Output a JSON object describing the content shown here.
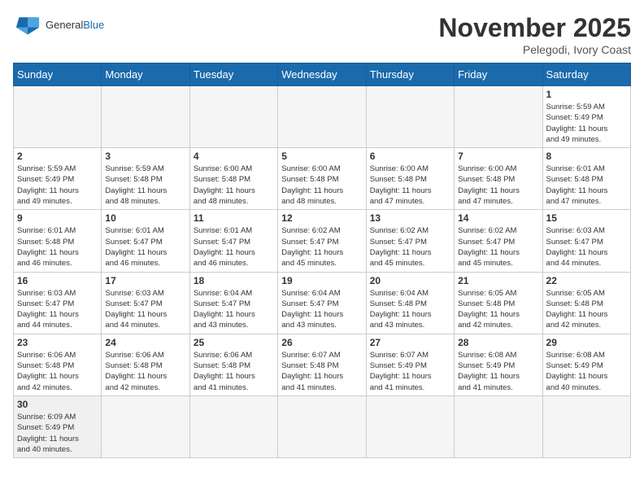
{
  "header": {
    "logo_general": "General",
    "logo_blue": "Blue",
    "month_title": "November 2025",
    "location": "Pelegodi, Ivory Coast"
  },
  "days_of_week": [
    "Sunday",
    "Monday",
    "Tuesday",
    "Wednesday",
    "Thursday",
    "Friday",
    "Saturday"
  ],
  "weeks": [
    [
      {
        "day": "",
        "info": ""
      },
      {
        "day": "",
        "info": ""
      },
      {
        "day": "",
        "info": ""
      },
      {
        "day": "",
        "info": ""
      },
      {
        "day": "",
        "info": ""
      },
      {
        "day": "",
        "info": ""
      },
      {
        "day": "1",
        "info": "Sunrise: 5:59 AM\nSunset: 5:49 PM\nDaylight: 11 hours\nand 49 minutes."
      }
    ],
    [
      {
        "day": "2",
        "info": "Sunrise: 5:59 AM\nSunset: 5:49 PM\nDaylight: 11 hours\nand 49 minutes."
      },
      {
        "day": "3",
        "info": "Sunrise: 5:59 AM\nSunset: 5:48 PM\nDaylight: 11 hours\nand 48 minutes."
      },
      {
        "day": "4",
        "info": "Sunrise: 6:00 AM\nSunset: 5:48 PM\nDaylight: 11 hours\nand 48 minutes."
      },
      {
        "day": "5",
        "info": "Sunrise: 6:00 AM\nSunset: 5:48 PM\nDaylight: 11 hours\nand 48 minutes."
      },
      {
        "day": "6",
        "info": "Sunrise: 6:00 AM\nSunset: 5:48 PM\nDaylight: 11 hours\nand 47 minutes."
      },
      {
        "day": "7",
        "info": "Sunrise: 6:00 AM\nSunset: 5:48 PM\nDaylight: 11 hours\nand 47 minutes."
      },
      {
        "day": "8",
        "info": "Sunrise: 6:01 AM\nSunset: 5:48 PM\nDaylight: 11 hours\nand 47 minutes."
      }
    ],
    [
      {
        "day": "9",
        "info": "Sunrise: 6:01 AM\nSunset: 5:48 PM\nDaylight: 11 hours\nand 46 minutes."
      },
      {
        "day": "10",
        "info": "Sunrise: 6:01 AM\nSunset: 5:47 PM\nDaylight: 11 hours\nand 46 minutes."
      },
      {
        "day": "11",
        "info": "Sunrise: 6:01 AM\nSunset: 5:47 PM\nDaylight: 11 hours\nand 46 minutes."
      },
      {
        "day": "12",
        "info": "Sunrise: 6:02 AM\nSunset: 5:47 PM\nDaylight: 11 hours\nand 45 minutes."
      },
      {
        "day": "13",
        "info": "Sunrise: 6:02 AM\nSunset: 5:47 PM\nDaylight: 11 hours\nand 45 minutes."
      },
      {
        "day": "14",
        "info": "Sunrise: 6:02 AM\nSunset: 5:47 PM\nDaylight: 11 hours\nand 45 minutes."
      },
      {
        "day": "15",
        "info": "Sunrise: 6:03 AM\nSunset: 5:47 PM\nDaylight: 11 hours\nand 44 minutes."
      }
    ],
    [
      {
        "day": "16",
        "info": "Sunrise: 6:03 AM\nSunset: 5:47 PM\nDaylight: 11 hours\nand 44 minutes."
      },
      {
        "day": "17",
        "info": "Sunrise: 6:03 AM\nSunset: 5:47 PM\nDaylight: 11 hours\nand 44 minutes."
      },
      {
        "day": "18",
        "info": "Sunrise: 6:04 AM\nSunset: 5:47 PM\nDaylight: 11 hours\nand 43 minutes."
      },
      {
        "day": "19",
        "info": "Sunrise: 6:04 AM\nSunset: 5:47 PM\nDaylight: 11 hours\nand 43 minutes."
      },
      {
        "day": "20",
        "info": "Sunrise: 6:04 AM\nSunset: 5:48 PM\nDaylight: 11 hours\nand 43 minutes."
      },
      {
        "day": "21",
        "info": "Sunrise: 6:05 AM\nSunset: 5:48 PM\nDaylight: 11 hours\nand 42 minutes."
      },
      {
        "day": "22",
        "info": "Sunrise: 6:05 AM\nSunset: 5:48 PM\nDaylight: 11 hours\nand 42 minutes."
      }
    ],
    [
      {
        "day": "23",
        "info": "Sunrise: 6:06 AM\nSunset: 5:48 PM\nDaylight: 11 hours\nand 42 minutes."
      },
      {
        "day": "24",
        "info": "Sunrise: 6:06 AM\nSunset: 5:48 PM\nDaylight: 11 hours\nand 42 minutes."
      },
      {
        "day": "25",
        "info": "Sunrise: 6:06 AM\nSunset: 5:48 PM\nDaylight: 11 hours\nand 41 minutes."
      },
      {
        "day": "26",
        "info": "Sunrise: 6:07 AM\nSunset: 5:48 PM\nDaylight: 11 hours\nand 41 minutes."
      },
      {
        "day": "27",
        "info": "Sunrise: 6:07 AM\nSunset: 5:49 PM\nDaylight: 11 hours\nand 41 minutes."
      },
      {
        "day": "28",
        "info": "Sunrise: 6:08 AM\nSunset: 5:49 PM\nDaylight: 11 hours\nand 41 minutes."
      },
      {
        "day": "29",
        "info": "Sunrise: 6:08 AM\nSunset: 5:49 PM\nDaylight: 11 hours\nand 40 minutes."
      }
    ],
    [
      {
        "day": "30",
        "info": "Sunrise: 6:09 AM\nSunset: 5:49 PM\nDaylight: 11 hours\nand 40 minutes."
      },
      {
        "day": "",
        "info": ""
      },
      {
        "day": "",
        "info": ""
      },
      {
        "day": "",
        "info": ""
      },
      {
        "day": "",
        "info": ""
      },
      {
        "day": "",
        "info": ""
      },
      {
        "day": "",
        "info": ""
      }
    ]
  ]
}
